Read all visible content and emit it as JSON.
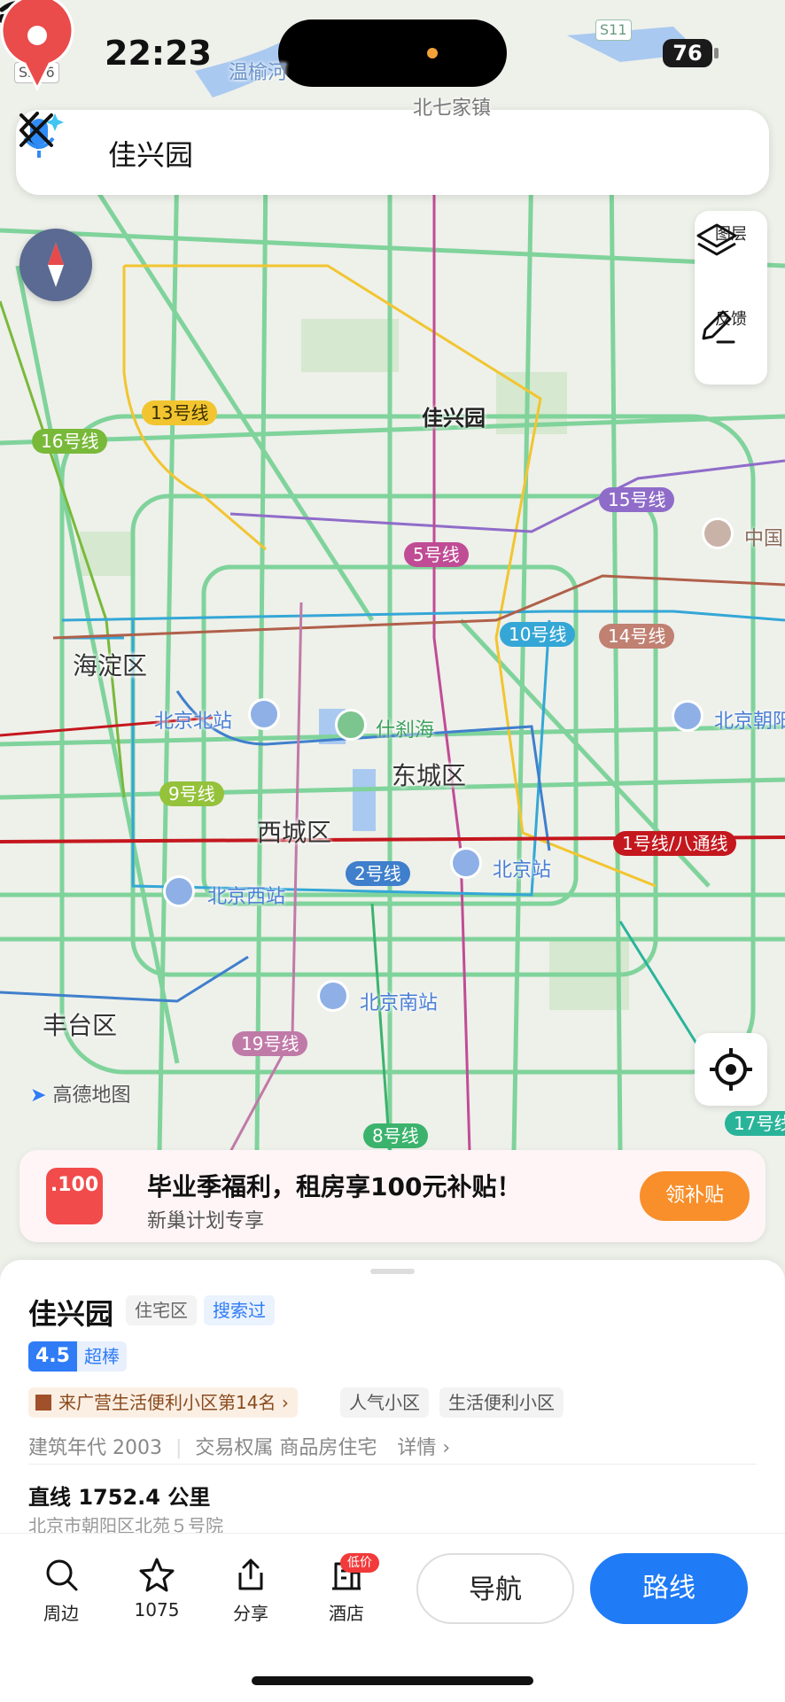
{
  "status": {
    "time": "22:23",
    "battery": "76"
  },
  "search": {
    "query": "佳兴园"
  },
  "map": {
    "pin_label": "佳兴园",
    "road_labels": [
      "S216",
      "S11",
      "温榆河",
      "北七家镇"
    ],
    "districts": [
      "海淀区",
      "东城区",
      "西城区",
      "丰台区"
    ],
    "lines": [
      {
        "label": "13号线",
        "color": "#f2c530"
      },
      {
        "label": "16号线",
        "color": "#79b93a"
      },
      {
        "label": "15号线",
        "color": "#8f6cc9"
      },
      {
        "label": "5号线",
        "color": "#c04c95"
      },
      {
        "label": "10号线",
        "color": "#34a7d6"
      },
      {
        "label": "14号线",
        "color": "#c08072"
      },
      {
        "label": "9号线",
        "color": "#94c23a"
      },
      {
        "label": "2号线",
        "color": "#3f7fcc"
      },
      {
        "label": "1号线/八通线",
        "color": "#c4171e"
      },
      {
        "label": "19号线",
        "color": "#c07aa8"
      },
      {
        "label": "8号线",
        "color": "#3bb36d"
      },
      {
        "label": "17号线",
        "color": "#29b49a"
      }
    ],
    "stations": [
      "北京北站",
      "北京站",
      "北京西站",
      "北京南站",
      "北京朝阳"
    ],
    "park": "什刹海",
    "poi": "中国",
    "brand": "高德地图",
    "tools": {
      "layers": "图层",
      "feedback": "反馈"
    }
  },
  "promo": {
    "icon_text": ".100",
    "title": "毕业季福利，租房享100元补贴！",
    "subtitle": "新巢计划专享",
    "button": "领补贴"
  },
  "place": {
    "name": "佳兴园",
    "type_tag": "住宅区",
    "searched_tag": "搜索过",
    "rating": "4.5",
    "rating_word": "超棒",
    "rank": "来广营生活便利小区第14名",
    "tags": [
      "人气小区",
      "生活便利小区"
    ],
    "build_year": "建筑年代 2003",
    "ownership": "交易权属 商品房住宅",
    "details": "详情",
    "distance": "直线 1752.4 公里",
    "address": "北京市朝阳区北苑５号院"
  },
  "bottom": {
    "nearby": "周边",
    "favorites": "1075",
    "share": "分享",
    "hotel": "酒店",
    "hotel_badge": "低价",
    "navigate": "导航",
    "route": "路线"
  },
  "colors": {
    "accent": "#1f7bf6",
    "pin": "#ea4b4b",
    "promo_button": "#f88f2a",
    "rating": "#2f7cf6"
  }
}
